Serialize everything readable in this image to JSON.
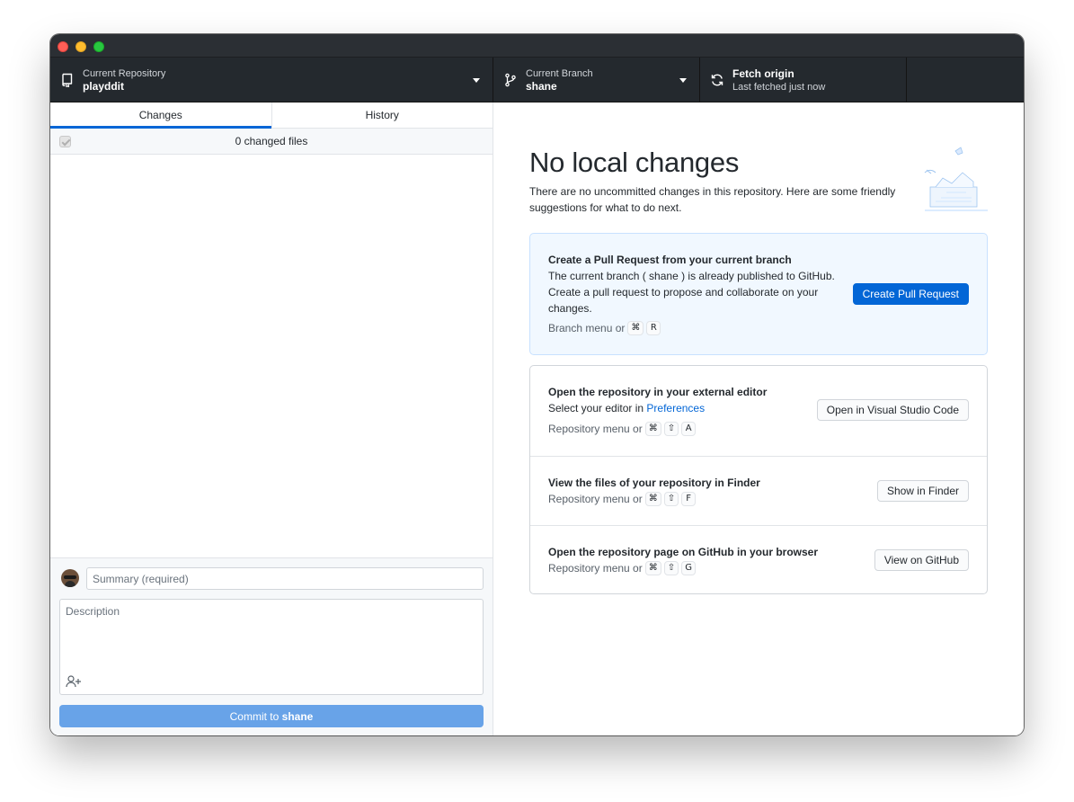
{
  "toolbar": {
    "repo": {
      "label": "Current Repository",
      "value": "playddit"
    },
    "branch": {
      "label": "Current Branch",
      "value": "shane"
    },
    "fetch": {
      "label": "Fetch origin",
      "status": "Last fetched just now"
    }
  },
  "sidebar": {
    "tabs": [
      {
        "label": "Changes",
        "active": true
      },
      {
        "label": "History",
        "active": false
      }
    ],
    "changed_files": "0 changed files"
  },
  "commit": {
    "summary_placeholder": "Summary (required)",
    "description_placeholder": "Description",
    "button_prefix": "Commit to",
    "button_branch": "shane"
  },
  "main": {
    "title": "No local changes",
    "intro": "There are no uncommitted changes in this repository. Here are some friendly suggestions for what to do next.",
    "pull_request": {
      "title": "Create a Pull Request from your current branch",
      "desc": "The current branch ( shane ) is already published to GitHub. Create a pull request to propose and collaborate on your changes.",
      "hint": "Branch menu or",
      "keys": [
        "⌘",
        "R"
      ],
      "button": "Create Pull Request"
    },
    "editor": {
      "title": "Open the repository in your external editor",
      "desc_prefix": "Select your editor in",
      "desc_link": "Preferences",
      "hint": "Repository menu or",
      "keys": [
        "⌘",
        "⇧",
        "A"
      ],
      "button": "Open in Visual Studio Code"
    },
    "finder": {
      "title": "View the files of your repository in Finder",
      "hint": "Repository menu or",
      "keys": [
        "⌘",
        "⇧",
        "F"
      ],
      "button": "Show in Finder"
    },
    "github": {
      "title": "Open the repository page on GitHub in your browser",
      "hint": "Repository menu or",
      "keys": [
        "⌘",
        "⇧",
        "G"
      ],
      "button": "View on GitHub"
    }
  },
  "colors": {
    "toolbar_bg": "#24292e",
    "accent": "#0366d6",
    "commit_button": "#68a3e8",
    "highlight_card": "#f1f8ff"
  },
  "icons": {
    "repo": "repo-icon",
    "branch": "git-branch-icon",
    "fetch": "sync-icon",
    "coauthor": "person-add-icon"
  }
}
